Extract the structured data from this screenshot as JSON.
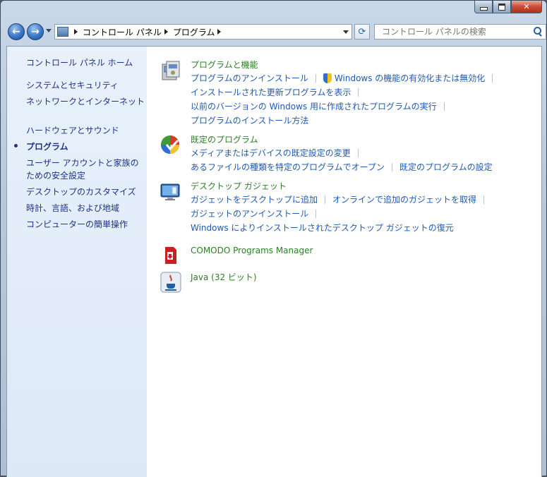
{
  "window": {
    "min_glyph": "",
    "max_glyph": "",
    "close_glyph": "✕"
  },
  "nav": {
    "back_glyph": "←",
    "forward_glyph": "→"
  },
  "address": {
    "crumbs": [
      "コントロール パネル",
      "プログラム"
    ]
  },
  "search": {
    "placeholder": "コントロール パネルの検索"
  },
  "sidebar": {
    "items": [
      {
        "label": "コントロール パネル ホーム"
      },
      {
        "label": "システムとセキュリティ"
      },
      {
        "label": "ネットワークとインターネット"
      },
      {
        "label": "ハードウェアとサウンド"
      },
      {
        "label": "プログラム"
      },
      {
        "label": "ユーザー アカウントと家族のための安全設定"
      },
      {
        "label": "デスクトップのカスタマイズ"
      },
      {
        "label": "時計、言語、および地域"
      },
      {
        "label": "コンピューターの簡単操作"
      }
    ]
  },
  "categories": [
    {
      "title": "プログラムと機能",
      "links": [
        [
          "プログラムのアンインストール",
          "Windows の機能の有効化または無効化"
        ],
        [
          "インストールされた更新プログラムを表示"
        ],
        [
          "以前のバージョンの Windows 用に作成されたプログラムの実行"
        ],
        [
          "プログラムのインストール方法"
        ]
      ]
    },
    {
      "title": "既定のプログラム",
      "links": [
        [
          "メディアまたはデバイスの既定設定の変更"
        ],
        [
          "あるファイルの種類を特定のプログラムでオープン",
          "既定のプログラムの設定"
        ]
      ]
    },
    {
      "title": "デスクトップ ガジェット",
      "links": [
        [
          "ガジェットをデスクトップに追加",
          "オンラインで追加のガジェットを取得"
        ],
        [
          "ガジェットのアンインストール"
        ],
        [
          "Windows によりインストールされたデスクトップ ガジェットの復元"
        ]
      ]
    },
    {
      "title": "COMODO Programs Manager",
      "links": []
    },
    {
      "title": "Java (32 ビット)",
      "links": []
    }
  ],
  "colors": {
    "category_title": "#2b7f23",
    "link": "#1f59b6",
    "sidebar_text": "#1e3287"
  }
}
